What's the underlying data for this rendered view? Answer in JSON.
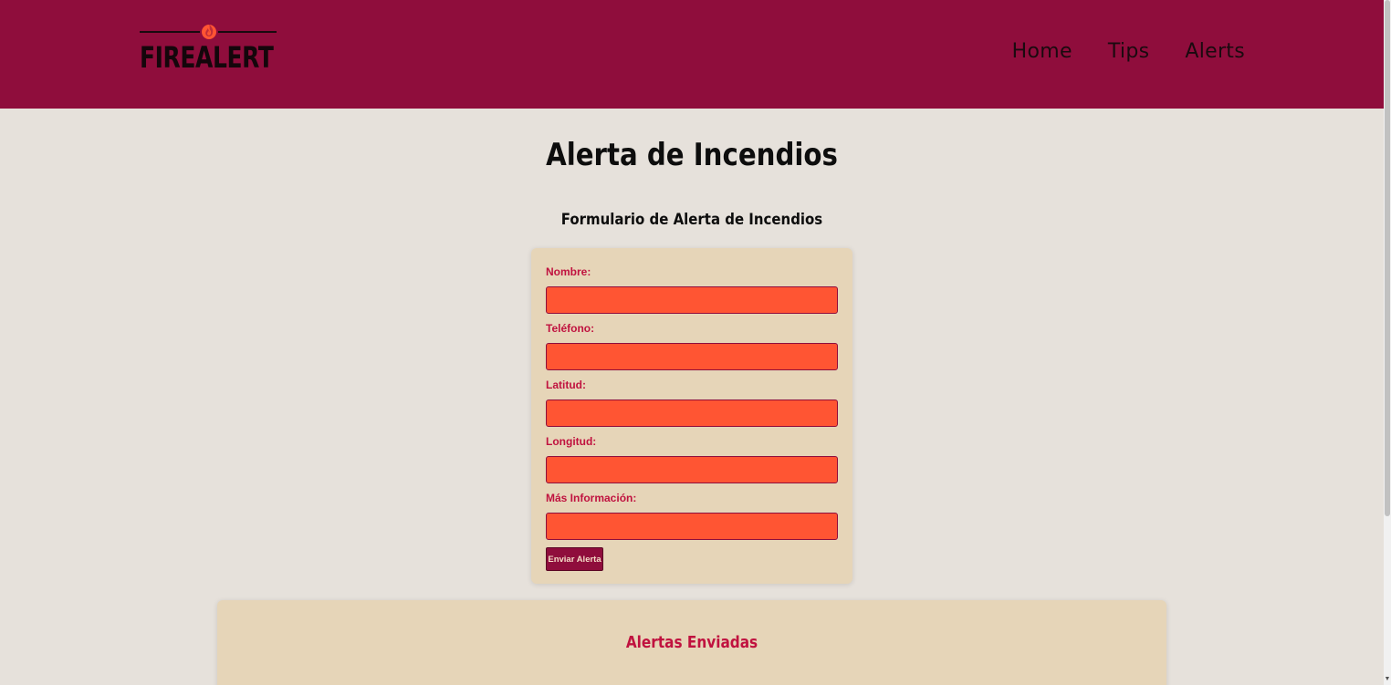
{
  "header": {
    "logo_text": "FIREALERT",
    "nav": [
      "Home",
      "Tips",
      "Alerts"
    ]
  },
  "main": {
    "title": "Alerta de Incendios",
    "form_title": "Formulario de Alerta de Incendios",
    "fields": [
      {
        "label": "Nombre:",
        "value": ""
      },
      {
        "label": "Teléfono:",
        "value": ""
      },
      {
        "label": "Latitud:",
        "value": ""
      },
      {
        "label": "Longitud:",
        "value": ""
      },
      {
        "label": "Más Información:",
        "value": ""
      }
    ],
    "submit_label": "Enviar Alerta"
  },
  "alerts": {
    "title": "Alertas Enviadas"
  },
  "colors": {
    "header_bg": "#8f0d3c",
    "page_bg": "#e6e1db",
    "card_bg": "#e6d5b8",
    "input_bg": "#ff5533",
    "accent_text": "#c0123f",
    "flame": "#ff5533"
  },
  "icons": {
    "logo_flame": "flame-icon"
  }
}
